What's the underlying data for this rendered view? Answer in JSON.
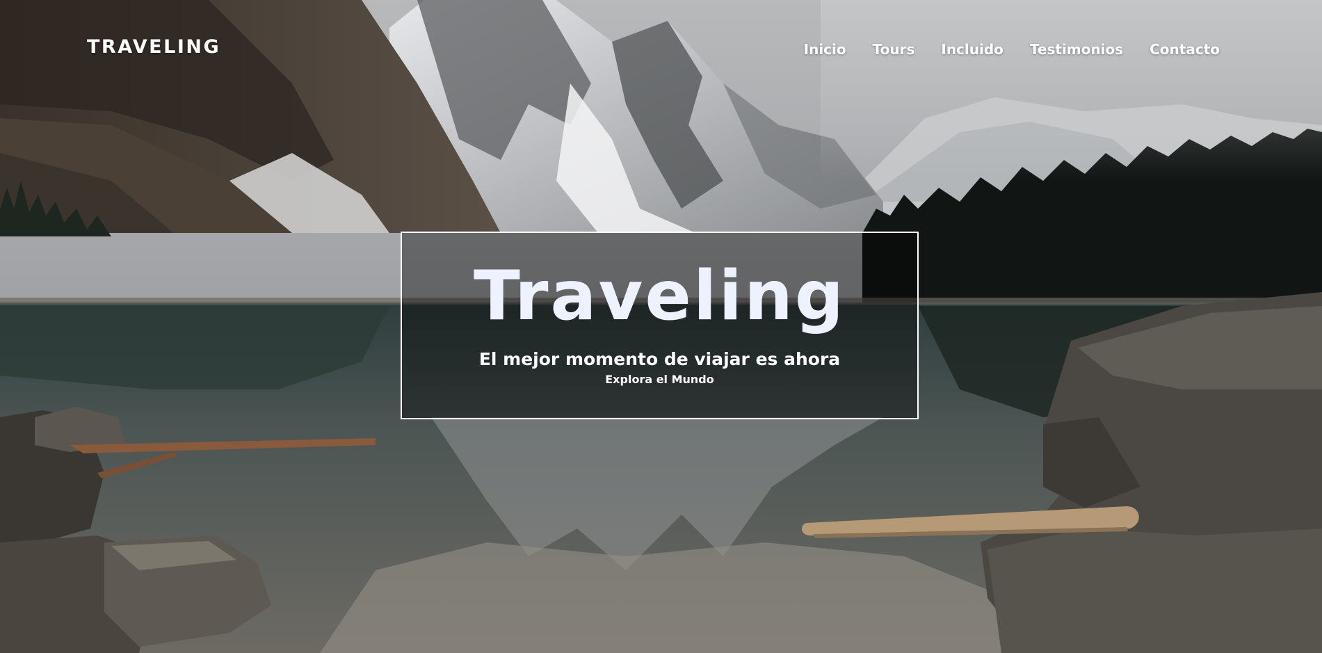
{
  "header": {
    "brand": "TRAVELING",
    "nav": [
      {
        "label": "Inicio"
      },
      {
        "label": "Tours"
      },
      {
        "label": "Incluido"
      },
      {
        "label": "Testimonios"
      },
      {
        "label": "Contacto"
      }
    ]
  },
  "hero": {
    "title": "Traveling",
    "subtitle": "El mejor momento de viajar es ahora",
    "tagline": "Explora el Mundo"
  },
  "colors": {
    "text": "#ffffff",
    "title": "#eef2ff",
    "overlay": "rgba(0,0,0,0.38)"
  }
}
